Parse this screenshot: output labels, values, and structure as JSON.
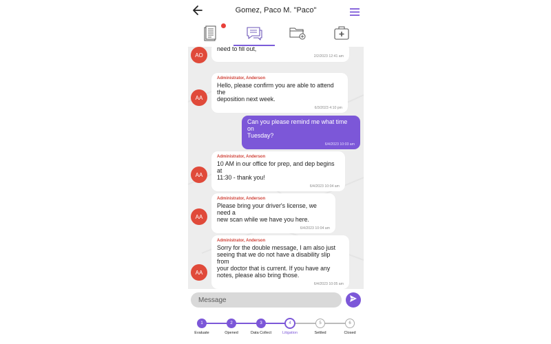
{
  "header": {
    "title": "Gomez, Paco M. \"Paco\"",
    "back_icon": "arrow-left-icon",
    "menu_icon": "hamburger-menu-icon"
  },
  "tabs": [
    {
      "name": "documents",
      "icon": "document-icon",
      "has_badge": true,
      "active": false
    },
    {
      "name": "messages",
      "icon": "chat-icon",
      "active": true
    },
    {
      "name": "files",
      "icon": "folder-icon",
      "active": false
    },
    {
      "name": "medical",
      "icon": "medical-kit-icon",
      "active": false
    }
  ],
  "messages": [
    {
      "initials": "AO",
      "sender": "",
      "lines": [
        "need to fill out,"
      ],
      "time": "2/2/2023 12:41 am",
      "sent": false
    },
    {
      "initials": "AA",
      "sender": "Administrator, Anderson",
      "lines": [
        "Hello, please confirm you are able to attend the",
        "deposition next week."
      ],
      "time": "6/3/2023 4:10 pm",
      "sent": false
    },
    {
      "initials": "",
      "sender": "",
      "lines": [
        "Can you please remind me what time on",
        "Tuesday?"
      ],
      "time": "6/4/2023 10:03 am",
      "sent": true
    },
    {
      "initials": "AA",
      "sender": "Administrator, Anderson",
      "lines": [
        "10 AM in our office for prep, and dep begins at",
        "11:30 - thank you!"
      ],
      "time": "6/4/2023 10:04 am",
      "sent": false
    },
    {
      "initials": "AA",
      "sender": "Administrator, Anderson",
      "lines": [
        "Please bring your driver's license, we need a",
        "new scan while we have you here."
      ],
      "time": "6/4/2023 10:04 am",
      "sent": false
    },
    {
      "initials": "AA",
      "sender": "Administrator, Anderson",
      "lines": [
        "Sorry for the double message, I am also just",
        "seeing that we do not have a disability slip from",
        "your doctor that is current.  If you have any",
        "notes, please also bring those."
      ],
      "time": "6/4/2023 10:05 am",
      "sent": false
    }
  ],
  "composer": {
    "placeholder": "Message",
    "send_icon": "send-icon"
  },
  "stepper": {
    "steps": [
      {
        "number": "1",
        "label": "Evaluate",
        "state": "done"
      },
      {
        "number": "2",
        "label": "Opened",
        "state": "done"
      },
      {
        "number": "3",
        "label": "Data Collect",
        "state": "done"
      },
      {
        "number": "4",
        "label": "Litigation",
        "state": "current"
      },
      {
        "number": "5",
        "label": "Settled",
        "state": "todo"
      },
      {
        "number": "6",
        "label": "Closed",
        "state": "todo"
      }
    ]
  },
  "colors": {
    "accent": "#7c57d8",
    "avatar": "#e04a3a",
    "sender_name": "#d0443a",
    "chat_background": "#ededed",
    "badge": "#e8403a"
  }
}
